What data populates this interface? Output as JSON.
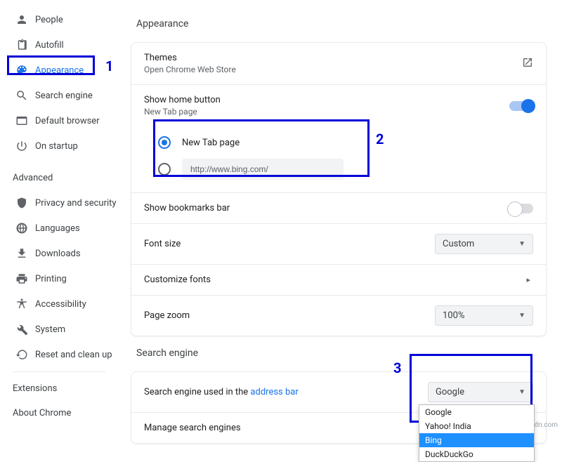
{
  "sidebar": {
    "items": [
      {
        "label": "People"
      },
      {
        "label": "Autofill"
      },
      {
        "label": "Appearance"
      },
      {
        "label": "Search engine"
      },
      {
        "label": "Default browser"
      },
      {
        "label": "On startup"
      }
    ],
    "advanced_label": "Advanced",
    "adv_items": [
      {
        "label": "Privacy and security"
      },
      {
        "label": "Languages"
      },
      {
        "label": "Downloads"
      },
      {
        "label": "Printing"
      },
      {
        "label": "Accessibility"
      },
      {
        "label": "System"
      },
      {
        "label": "Reset and clean up"
      }
    ],
    "extensions": "Extensions",
    "about": "About Chrome"
  },
  "appearance": {
    "title": "Appearance",
    "themes": {
      "title": "Themes",
      "sub": "Open Chrome Web Store"
    },
    "home_button": {
      "title": "Show home button",
      "sub": "New Tab page"
    },
    "radio": {
      "new_tab": "New Tab page",
      "custom_url": "http://www.bing.com/"
    },
    "bookmarks": "Show bookmarks bar",
    "font_size": {
      "label": "Font size",
      "value": "Custom"
    },
    "customize_fonts": "Customize fonts",
    "zoom": {
      "label": "Page zoom",
      "value": "100%"
    }
  },
  "search": {
    "title": "Search engine",
    "used_in_prefix": "Search engine used in the ",
    "used_in_link": "address bar",
    "dropdown_value": "Google",
    "options": [
      "Google",
      "Yahoo! India",
      "Bing",
      "DuckDuckGo"
    ],
    "manage": "Manage search engines"
  },
  "annotations": {
    "a1": "1",
    "a2": "2",
    "a3": "3"
  },
  "watermark": "wsxdn.com"
}
